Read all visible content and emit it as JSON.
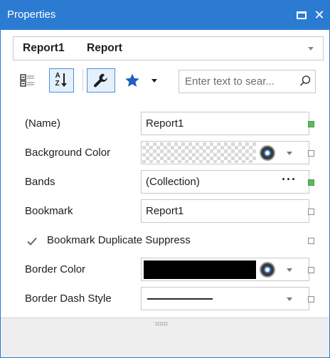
{
  "window": {
    "title": "Properties"
  },
  "selector": {
    "object_name": "Report1",
    "object_type": "Report"
  },
  "toolbar": {
    "search_placeholder": "Enter text to sear...",
    "buttons": [
      "categorized-view",
      "alphabetical-sort",
      "properties",
      "favorites",
      "favorites-dropdown"
    ]
  },
  "properties": [
    {
      "label": "(Name)",
      "value": "Report1",
      "modified": true
    },
    {
      "label": "Background Color",
      "value": "",
      "modified": false
    },
    {
      "label": "Bands",
      "value": "(Collection)",
      "button": "···",
      "modified": true
    },
    {
      "label": "Bookmark",
      "value": "Report1",
      "modified": false
    },
    {
      "label": "Bookmark Duplicate Suppress",
      "checked": true,
      "modified": false
    },
    {
      "label": "Border Color",
      "value": "",
      "modified": false
    },
    {
      "label": "Border Dash Style",
      "value": "",
      "modified": false
    }
  ],
  "colors": {
    "accent": "#2b7bd3",
    "modified_marker": "#5cb85c",
    "border_color_swatch": "#000000"
  }
}
